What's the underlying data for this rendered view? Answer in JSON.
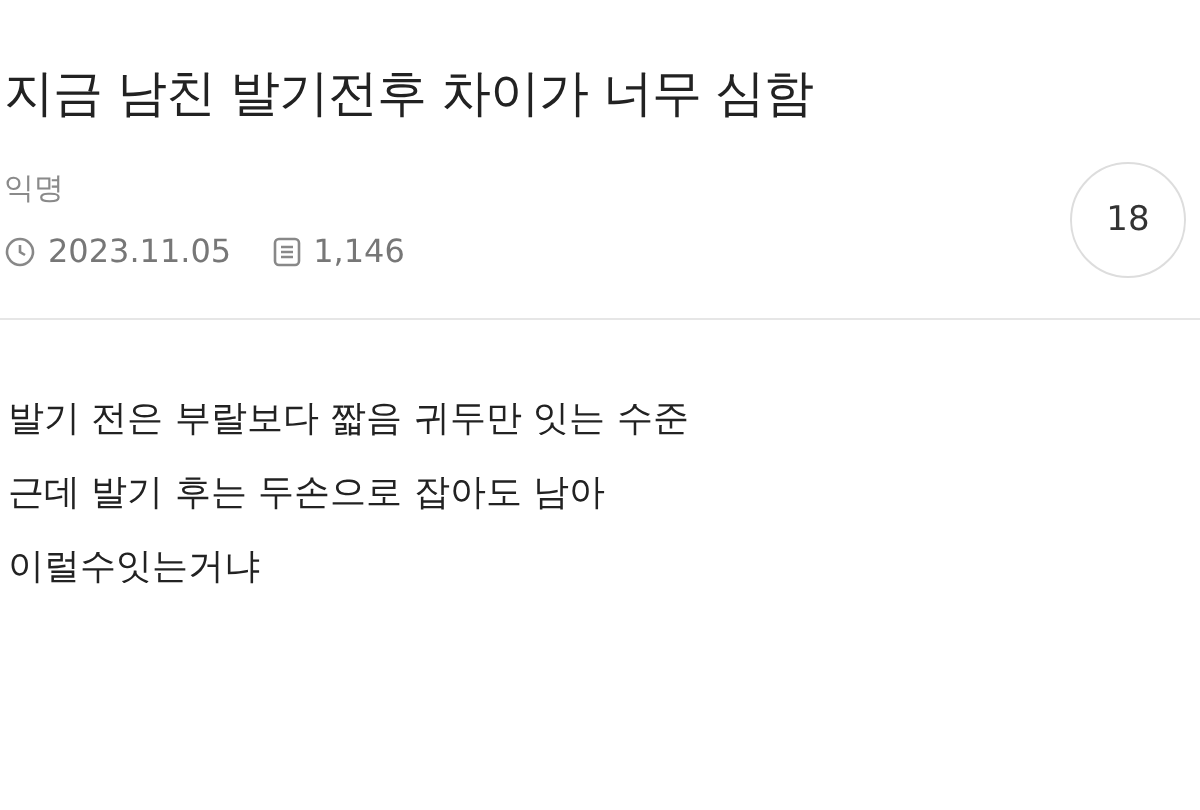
{
  "post": {
    "title": "지금 남친 발기전후 차이가 너무 심함",
    "author": "익명",
    "date": "2023.11.05",
    "views": "1,146",
    "comment_count": "18",
    "body": [
      "발기 전은 부랄보다 짧음 귀두만 잇는 수준",
      "근데 발기 후는 두손으로 잡아도 남아",
      "이럴수잇는거냐"
    ]
  }
}
